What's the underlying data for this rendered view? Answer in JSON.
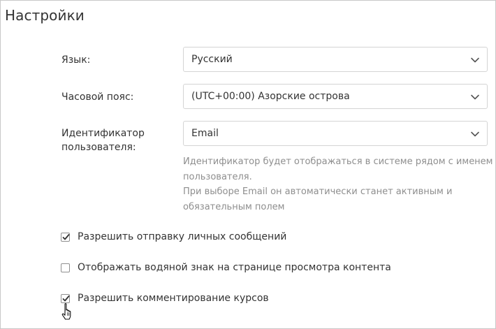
{
  "page": {
    "title": "Настройки"
  },
  "fields": {
    "language": {
      "label": "Язык:",
      "value": "Русский"
    },
    "timezone": {
      "label": "Часовой пояс:",
      "value": "(UTC+00:00) Азорские острова"
    },
    "user_identifier": {
      "label_line1": "Идентификатор",
      "label_line2": "пользователя:",
      "value": "Email",
      "hint_line1": "Идентификатор будет отображаться в системе рядом с именем",
      "hint_line2": "пользователя.",
      "hint_line3": "При выборе Email он автоматически станет активным и",
      "hint_line4": "обязательным полем"
    }
  },
  "options": {
    "private_messages": {
      "label": "Разрешить отправку личных сообщений",
      "checked": true
    },
    "watermark": {
      "label": "Отображать водяной знак на странице просмотра контента",
      "checked": false
    },
    "course_comments": {
      "label": "Разрешить комментирование курсов",
      "checked": true
    }
  },
  "icons": {
    "dropdown": "chevron-down-icon",
    "check": "checkmark-icon",
    "cursor": "hand-pointer-cursor"
  },
  "colors": {
    "text": "#333333",
    "hint": "#8e8e8e",
    "border": "#d4d4d4",
    "checkbox_border": "#8f8f8f"
  }
}
